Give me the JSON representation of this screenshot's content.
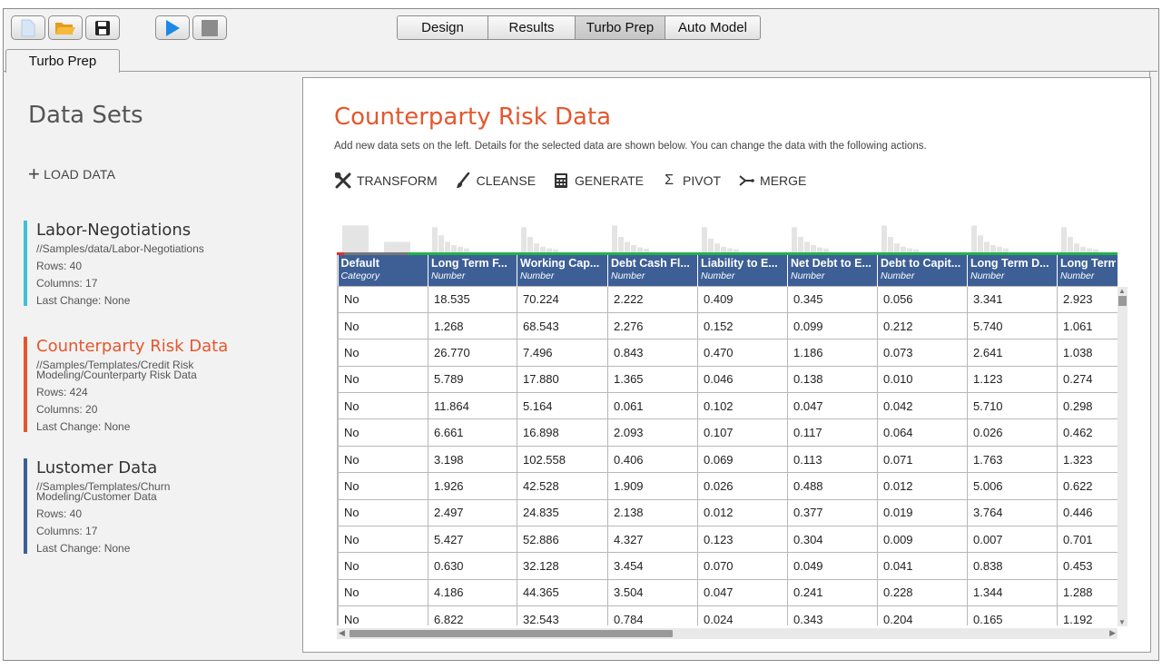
{
  "toolbar": {
    "new_icon": "new-file-icon",
    "open_icon": "open-folder-icon",
    "save_icon": "save-disk-icon",
    "run_icon": "play-icon",
    "stop_icon": "stop-icon",
    "views": [
      "Design",
      "Results",
      "Turbo Prep",
      "Auto Model"
    ],
    "active_view": "Turbo Prep"
  },
  "perspective_tab": "Turbo Prep",
  "sidebar": {
    "title": "Data Sets",
    "load_label": "LOAD DATA",
    "datasets": [
      {
        "name": "Labor-Negotiations",
        "path": "//Samples/data/Labor-Negotiations",
        "rows": "Rows: 40",
        "columns": "Columns: 17",
        "last_change": "Last Change: None",
        "color": "#3fc1d6",
        "selected": false
      },
      {
        "name": "Counterparty Risk Data",
        "path": "//Samples/Templates/Credit Risk Modeling/Counterparty Risk Data",
        "rows": "Rows: 424",
        "columns": "Columns: 20",
        "last_change": "Last Change: None",
        "color": "#e4572e",
        "selected": true
      },
      {
        "name": "Lustomer Data",
        "path": "//Samples/Templates/Churn Modeling/Customer Data",
        "rows": "Rows: 40",
        "columns": "Columns: 17",
        "last_change": "Last Change: None",
        "color": "#3d5f96",
        "selected": false
      }
    ]
  },
  "main": {
    "title": "Counterparty Risk Data",
    "description": "Add new data sets on the left. Details for the selected data are shown below. You can change the data with the following actions.",
    "actions": [
      {
        "label": "TRANSFORM",
        "icon": "tools-icon"
      },
      {
        "label": "CLEANSE",
        "icon": "brush-icon"
      },
      {
        "label": "GENERATE",
        "icon": "calculator-icon"
      },
      {
        "label": "PIVOT",
        "icon": "sigma-icon"
      },
      {
        "label": "MERGE",
        "icon": "merge-icon"
      }
    ]
  },
  "table": {
    "columns": [
      {
        "name": "Default",
        "type": "Category"
      },
      {
        "name": "Long Term F...",
        "type": "Number"
      },
      {
        "name": "Working Cap...",
        "type": "Number"
      },
      {
        "name": "Debt Cash Fl...",
        "type": "Number"
      },
      {
        "name": "Liability to E...",
        "type": "Number"
      },
      {
        "name": "Net Debt to E...",
        "type": "Number"
      },
      {
        "name": "Debt to Capit...",
        "type": "Number"
      },
      {
        "name": "Long Term D...",
        "type": "Number"
      },
      {
        "name": "Long Term",
        "type": "Number"
      }
    ],
    "rows": [
      [
        "No",
        "18.535",
        "70.224",
        "2.222",
        "0.409",
        "0.345",
        "0.056",
        "3.341",
        "2.923"
      ],
      [
        "No",
        "1.268",
        "68.543",
        "2.276",
        "0.152",
        "0.099",
        "0.212",
        "5.740",
        "1.061"
      ],
      [
        "No",
        "26.770",
        "7.496",
        "0.843",
        "0.470",
        "1.186",
        "0.073",
        "2.641",
        "1.038"
      ],
      [
        "No",
        "5.789",
        "17.880",
        "1.365",
        "0.046",
        "0.138",
        "0.010",
        "1.123",
        "0.274"
      ],
      [
        "No",
        "11.864",
        "5.164",
        "0.061",
        "0.102",
        "0.047",
        "0.042",
        "5.710",
        "0.298"
      ],
      [
        "No",
        "6.661",
        "16.898",
        "2.093",
        "0.107",
        "0.117",
        "0.064",
        "0.026",
        "0.462"
      ],
      [
        "No",
        "3.198",
        "102.558",
        "0.406",
        "0.069",
        "0.113",
        "0.071",
        "1.763",
        "1.323"
      ],
      [
        "No",
        "1.926",
        "42.528",
        "1.909",
        "0.026",
        "0.488",
        "0.012",
        "5.006",
        "0.622"
      ],
      [
        "No",
        "2.497",
        "24.835",
        "2.138",
        "0.012",
        "0.377",
        "0.019",
        "3.764",
        "0.446"
      ],
      [
        "No",
        "5.427",
        "52.886",
        "4.327",
        "0.123",
        "0.304",
        "0.009",
        "0.007",
        "0.701"
      ],
      [
        "No",
        "0.630",
        "32.128",
        "3.454",
        "0.070",
        "0.049",
        "0.041",
        "0.838",
        "0.453"
      ],
      [
        "No",
        "4.186",
        "44.365",
        "3.504",
        "0.047",
        "0.241",
        "0.228",
        "1.344",
        "1.288"
      ],
      [
        "No",
        "6.822",
        "32.543",
        "0.784",
        "0.024",
        "0.343",
        "0.204",
        "0.165",
        "1.192"
      ]
    ],
    "histograms": [
      [
        0.85,
        0.35
      ],
      [
        0.8,
        0.55,
        0.35,
        0.25,
        0.2,
        0.15
      ],
      [
        0.8,
        0.5,
        0.3,
        0.2,
        0.15,
        0.12
      ],
      [
        0.85,
        0.5,
        0.35,
        0.25,
        0.18,
        0.14
      ],
      [
        0.8,
        0.45,
        0.3,
        0.2,
        0.15,
        0.12
      ],
      [
        0.8,
        0.5,
        0.35,
        0.25,
        0.18,
        0.14
      ],
      [
        0.85,
        0.5,
        0.3,
        0.2,
        0.15,
        0.12
      ],
      [
        0.85,
        0.55,
        0.35,
        0.25,
        0.2,
        0.15
      ],
      [
        0.8,
        0.5,
        0.3,
        0.2,
        0.15,
        0.12
      ]
    ]
  }
}
